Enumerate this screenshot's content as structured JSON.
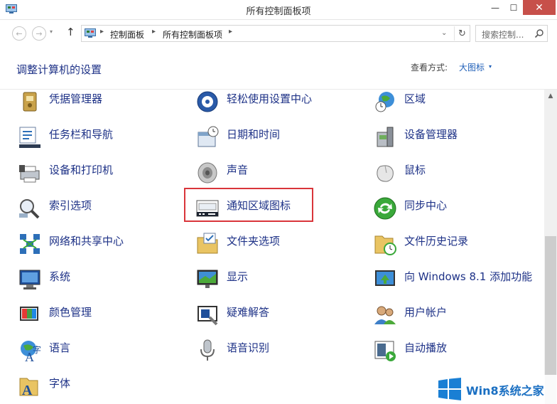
{
  "window": {
    "title": "所有控制面板项",
    "minimize": "—",
    "maximize": "☐",
    "close": "✕"
  },
  "nav": {
    "back": "←",
    "forward": "→",
    "up": "↑",
    "dropdown": "▾",
    "breadcrumb": [
      "控制面板",
      "所有控制面板项"
    ],
    "breadcrumb_sep": "▸",
    "address_dropdown": "⌄",
    "refresh": "↻",
    "search_placeholder": "搜索控制..."
  },
  "header": {
    "title": "调整计算机的设置",
    "view_label": "查看方式:",
    "view_value": "大图标",
    "view_dropdown": "▾"
  },
  "items": [
    {
      "label": "凭据管理器",
      "icon": "credential-manager-icon"
    },
    {
      "label": "轻松使用设置中心",
      "icon": "ease-of-access-icon"
    },
    {
      "label": "区域",
      "icon": "region-icon"
    },
    {
      "label": "任务栏和导航",
      "icon": "taskbar-icon"
    },
    {
      "label": "日期和时间",
      "icon": "date-time-icon"
    },
    {
      "label": "设备管理器",
      "icon": "device-manager-icon"
    },
    {
      "label": "设备和打印机",
      "icon": "devices-printers-icon"
    },
    {
      "label": "声音",
      "icon": "sound-icon"
    },
    {
      "label": "鼠标",
      "icon": "mouse-icon"
    },
    {
      "label": "索引选项",
      "icon": "indexing-icon"
    },
    {
      "label": "通知区域图标",
      "icon": "notification-area-icon"
    },
    {
      "label": "同步中心",
      "icon": "sync-center-icon"
    },
    {
      "label": "网络和共享中心",
      "icon": "network-icon"
    },
    {
      "label": "文件夹选项",
      "icon": "folder-options-icon"
    },
    {
      "label": "文件历史记录",
      "icon": "file-history-icon"
    },
    {
      "label": "系统",
      "icon": "system-icon"
    },
    {
      "label": "显示",
      "icon": "display-icon"
    },
    {
      "label": "向 Windows 8.1 添加功能",
      "icon": "add-features-icon"
    },
    {
      "label": "颜色管理",
      "icon": "color-management-icon"
    },
    {
      "label": "疑难解答",
      "icon": "troubleshooting-icon"
    },
    {
      "label": "用户帐户",
      "icon": "user-accounts-icon"
    },
    {
      "label": "语言",
      "icon": "language-icon"
    },
    {
      "label": "语音识别",
      "icon": "speech-recognition-icon"
    },
    {
      "label": "自动播放",
      "icon": "autoplay-icon"
    },
    {
      "label": "字体",
      "icon": "fonts-icon"
    }
  ],
  "scrollbar": {
    "up": "▲"
  },
  "watermark": {
    "text": "Win8系统之家"
  }
}
